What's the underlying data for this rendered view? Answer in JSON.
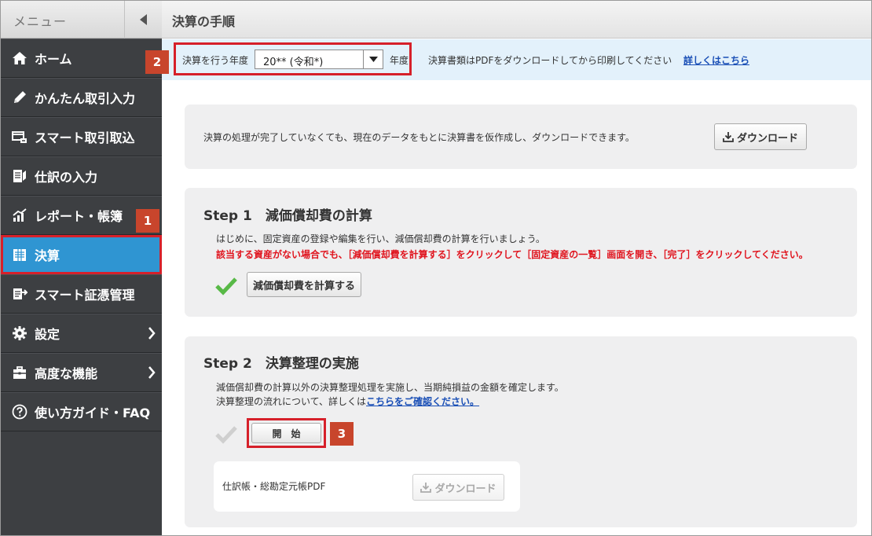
{
  "sidebar": {
    "menu_title": "メニュー",
    "items": [
      {
        "label": "ホーム",
        "icon": "home-icon"
      },
      {
        "label": "かんたん取引入力",
        "icon": "pencil-icon"
      },
      {
        "label": "スマート取引取込",
        "icon": "card-import-icon"
      },
      {
        "label": "仕訳の入力",
        "icon": "journal-icon"
      },
      {
        "label": "レポート・帳簿",
        "icon": "chart-icon"
      },
      {
        "label": "決算",
        "icon": "settlement-icon"
      },
      {
        "label": "スマート証憑管理",
        "icon": "document-scan-icon"
      },
      {
        "label": "設定",
        "icon": "gear-icon"
      },
      {
        "label": "高度な機能",
        "icon": "toolbox-icon"
      },
      {
        "label": "使い方ガイド・FAQ",
        "icon": "help-icon"
      }
    ]
  },
  "badges": {
    "b1": "1",
    "b2": "2",
    "b3": "3"
  },
  "header": {
    "title": "決算の手順"
  },
  "year_bar": {
    "label": "決算を行う年度",
    "selected": "20** (令和*)",
    "suffix": "年度",
    "note": "決算書類はPDFをダウンロードしてから印刷してください",
    "link": "詳しくはこちら"
  },
  "preview_card": {
    "text": "決算の処理が完了していなくても、現在のデータをもとに決算書を仮作成し、ダウンロードできます。",
    "download": "ダウンロード"
  },
  "step1": {
    "title": "Step 1　減価償却費の計算",
    "line1": "はじめに、固定資産の登録や編集を行い、減価償却費の計算を行いましょう。",
    "line2": "該当する資産がない場合でも、［減価償却費を計算する］をクリックして［固定資産の一覧］画面を開き、［完了］をクリックしてください。",
    "button": "減価償却費を計算する"
  },
  "step2": {
    "title": "Step 2　決算整理の実施",
    "line1": "減価償却費の計算以外の決算整理処理を実施し、当期純損益の金額を確定します。",
    "line2_prefix": "決算整理の流れについて、詳しくは",
    "line2_link": "こちらをご確認ください。",
    "start": "開　始",
    "pdf_label": "仕訳帳・総勘定元帳PDF",
    "pdf_download": "ダウンロード"
  },
  "colors": {
    "sidebar": "#3d3f42",
    "active": "#2f95d2",
    "highlight": "#d6202a",
    "badge": "#c8452c",
    "check": "#58b947"
  }
}
